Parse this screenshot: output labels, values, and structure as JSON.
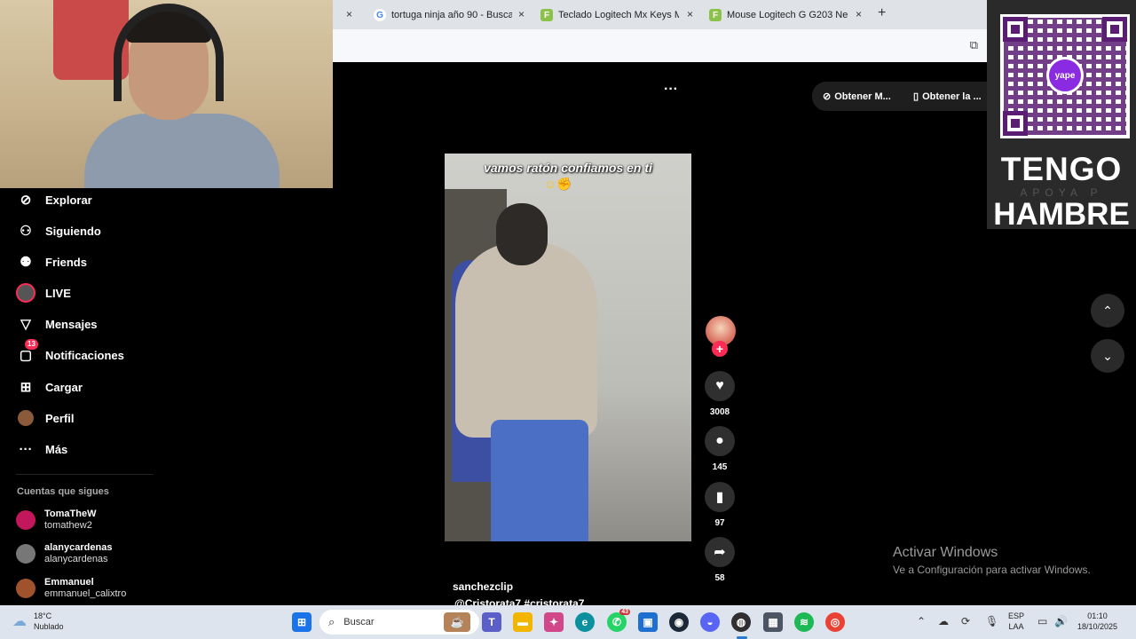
{
  "browser": {
    "tabs": [
      {
        "title": "tortuga ninja año 90 - Buscar con Google",
        "favicon": "G",
        "type": "g"
      },
      {
        "title": "Teclado Logitech Mx Keys Mini",
        "favicon": "F",
        "type": "f"
      },
      {
        "title": "Mouse Logitech G G203 Negro",
        "favicon": "F",
        "type": "f"
      }
    ],
    "close_glyph": "×",
    "new_tab_glyph": "+"
  },
  "overlay": {
    "qr_logo_text": "yape",
    "line1": "TENGO",
    "line2": "APOYA P",
    "line3": "HAMBRE"
  },
  "sidebar": {
    "items": [
      {
        "label": "Explorar",
        "icon": "compass-icon"
      },
      {
        "label": "Siguiendo",
        "icon": "user-follow-icon"
      },
      {
        "label": "Friends",
        "icon": "friends-icon"
      },
      {
        "label": "LIVE",
        "icon": "live-icon"
      },
      {
        "label": "Mensajes",
        "icon": "send-icon"
      },
      {
        "label": "Notificaciones",
        "icon": "inbox-icon",
        "badge": "13"
      },
      {
        "label": "Cargar",
        "icon": "upload-icon"
      },
      {
        "label": "Perfil",
        "icon": "profile-icon"
      },
      {
        "label": "Más",
        "icon": "more-icon"
      }
    ],
    "following_title": "Cuentas que sigues",
    "accounts": [
      {
        "name": "TomaTheW",
        "handle": "tomathew2",
        "color": "#c2185b"
      },
      {
        "name": "alanycardenas",
        "handle": "alanycardenas",
        "color": "#777777"
      },
      {
        "name": "Emmanuel",
        "handle": "emmanuel_calixtro",
        "color": "#a0522d"
      }
    ]
  },
  "video": {
    "caption": "vamos ratón confiamos en ti",
    "author": "sanchezclip",
    "tags": "@Cristorata7 #cristorata7",
    "likes": "3008",
    "comments": "145",
    "saves": "97",
    "shares": "58"
  },
  "top_buttons": {
    "get_app": "Obtener M...",
    "get_app2": "Obtener la ..."
  },
  "watermark": {
    "title": "Activar Windows",
    "subtitle": "Ve a Configuración para activar Windows."
  },
  "taskbar": {
    "temp": "18°C",
    "weather": "Nublado",
    "search_placeholder": "Buscar",
    "whatsapp_badge": "43",
    "lang1": "ESP",
    "lang2": "LAA",
    "time": "01:10",
    "date": "18/10/2025"
  }
}
